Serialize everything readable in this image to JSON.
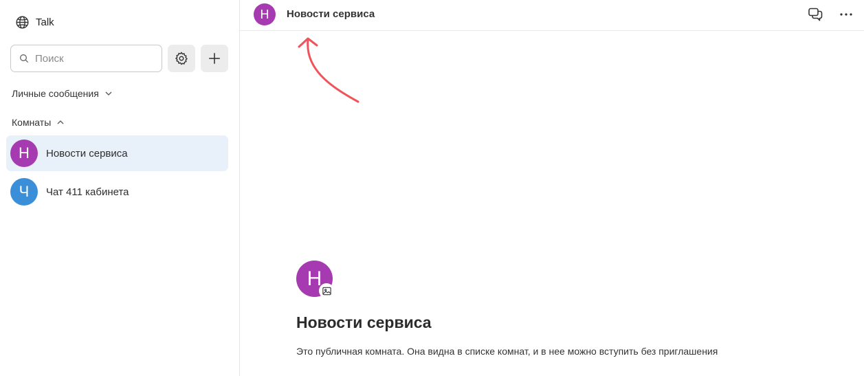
{
  "app": {
    "title": "Talk"
  },
  "colors": {
    "room_purple": "#a63ab0",
    "room_blue": "#3a8fd8",
    "active_bg": "#e8f0fa",
    "arrow_red": "#f0535a"
  },
  "sidebar": {
    "search": {
      "placeholder": "Поиск",
      "value": ""
    },
    "settings_icon": "gear-icon",
    "add_icon": "plus-icon",
    "sections": {
      "direct_messages": {
        "label": "Личные сообщения",
        "state": "collapsed"
      },
      "rooms": {
        "label": "Комнаты",
        "state": "expanded"
      }
    },
    "rooms": [
      {
        "initial": "Н",
        "name": "Новости сервиса",
        "color": "#a63ab0",
        "active": true
      },
      {
        "initial": "Ч",
        "name": "Чат 411 кабинета",
        "color": "#3a8fd8",
        "active": false
      }
    ]
  },
  "header": {
    "avatar_initial": "Н",
    "title": "Новости сервиса",
    "threads_icon": "threads-icon",
    "more_icon": "more-icon"
  },
  "room_intro": {
    "avatar_initial": "Н",
    "title": "Новости сервиса",
    "description": "Это публичная комната. Она видна в списке комнат, и в нее можно вступить без приглашения"
  }
}
